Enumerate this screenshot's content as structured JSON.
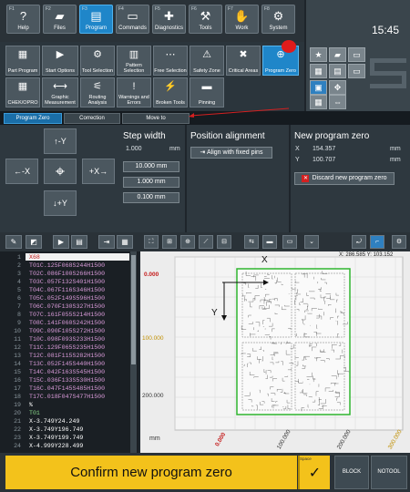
{
  "fkeys": [
    {
      "fn": "F1",
      "label": "Help",
      "icon": "?"
    },
    {
      "fn": "F2",
      "label": "Files",
      "icon": "▰"
    },
    {
      "fn": "F3",
      "label": "Program",
      "icon": "▤"
    },
    {
      "fn": "F4",
      "label": "Commands",
      "icon": "▭"
    },
    {
      "fn": "F5",
      "label": "Diagnostics",
      "icon": "✚"
    },
    {
      "fn": "F6",
      "label": "Tools",
      "icon": "⚒"
    },
    {
      "fn": "F7",
      "label": "Work",
      "icon": "✋"
    },
    {
      "fn": "F8",
      "label": "System",
      "icon": "⚙"
    }
  ],
  "clock": "15:45",
  "softkeys_row1": [
    {
      "label": "Part Program",
      "icon": "▦"
    },
    {
      "label": "Start Options",
      "icon": "▶"
    },
    {
      "label": "Tool Selection",
      "icon": "⚙"
    },
    {
      "label": "Pattern Selection",
      "icon": "▥"
    },
    {
      "label": "Free Selection",
      "icon": "⋯"
    },
    {
      "label": "Safety Zone",
      "icon": "⚠"
    },
    {
      "label": "Critical Areas",
      "icon": "✖"
    },
    {
      "label": "Program Zero",
      "icon": "⊕"
    }
  ],
  "softkeys_row2": [
    {
      "label": "CHEK/OPRO",
      "icon": "▦"
    },
    {
      "label": "Graphic Measurement",
      "icon": "⟷"
    },
    {
      "label": "Routing Analysis",
      "icon": "⚟"
    },
    {
      "label": "Warnings and Errors",
      "icon": "!"
    },
    {
      "label": "Broken Tools",
      "icon": "⚡"
    },
    {
      "label": "Pinning",
      "icon": "▬"
    }
  ],
  "tabs": [
    "Program Zero",
    "Correction",
    "Move to"
  ],
  "jog": {
    "up": "↑-Y",
    "left": "←-X",
    "right": "+X→",
    "down": "↓+Y"
  },
  "step": {
    "title": "Step width",
    "value": "1.000",
    "unit": "mm",
    "opts": [
      "10.000 mm",
      "1.000 mm",
      "0.100 mm"
    ]
  },
  "align": {
    "title": "Position alignment",
    "btn": "Align with fixed pins"
  },
  "newzero": {
    "title": "New program zero",
    "x_label": "X",
    "x": "154.357",
    "y_label": "Y",
    "y": "100.707",
    "unit": "mm",
    "discard": "Discard new program zero"
  },
  "code_lines": [
    {
      "n": "1",
      "t": "X68",
      "c": "w"
    },
    {
      "n": "2",
      "t": "T01C.125F068S244H1500",
      "c": ""
    },
    {
      "n": "3",
      "t": "T02C.086F100S266H1500",
      "c": ""
    },
    {
      "n": "4",
      "t": "T03C.057F132S401H1500",
      "c": ""
    },
    {
      "n": "5",
      "t": "T04C.067F116S346H1500",
      "c": ""
    },
    {
      "n": "6",
      "t": "T05C.052F149S596H1500",
      "c": ""
    },
    {
      "n": "7",
      "t": "T06C.070F130S327H1500",
      "c": ""
    },
    {
      "n": "8",
      "t": "T07C.161F055S214H1500",
      "c": ""
    },
    {
      "n": "9",
      "t": "T08C.141F060S242H1500",
      "c": ""
    },
    {
      "n": "10",
      "t": "T09C.090F105S272H1500",
      "c": ""
    },
    {
      "n": "11",
      "t": "T10C.098F093S233H1500",
      "c": ""
    },
    {
      "n": "12",
      "t": "T11C.129F065S235H1500",
      "c": ""
    },
    {
      "n": "13",
      "t": "T12C.081F115S282H1500",
      "c": ""
    },
    {
      "n": "14",
      "t": "T13C.052F145S440H1500",
      "c": ""
    },
    {
      "n": "15",
      "t": "T14C.042F163S545H1500",
      "c": ""
    },
    {
      "n": "16",
      "t": "T15C.036F133S530H1500",
      "c": ""
    },
    {
      "n": "17",
      "t": "T16C.047F145S485H1500",
      "c": ""
    },
    {
      "n": "18",
      "t": "T17C.018F047S477H1500",
      "c": ""
    },
    {
      "n": "19",
      "t": "%",
      "c": "w"
    },
    {
      "n": "20",
      "t": "T01",
      "c": "g"
    },
    {
      "n": "21",
      "t": "X-3.749Y24.249",
      "c": "w"
    },
    {
      "n": "22",
      "t": "X-3.749Y196.749",
      "c": "w"
    },
    {
      "n": "23",
      "t": "X-3.749Y199.749",
      "c": "w"
    },
    {
      "n": "24",
      "t": "X-4.999Y228.499",
      "c": "w"
    }
  ],
  "plot": {
    "coords": "X: 286.585  Y: 103.152",
    "y_ticks": [
      "0.000",
      "100.000",
      "200.000"
    ],
    "x_ticks": [
      "0.000",
      "100.000",
      "200.000",
      "300.000"
    ],
    "unit": "mm",
    "axis_x": "X",
    "axis_y": "Y"
  },
  "bottom": {
    "confirm": "Confirm new program zero",
    "space": "Space",
    "check": "✓",
    "block": "BLOCK",
    "notool": "NOTOOL"
  }
}
